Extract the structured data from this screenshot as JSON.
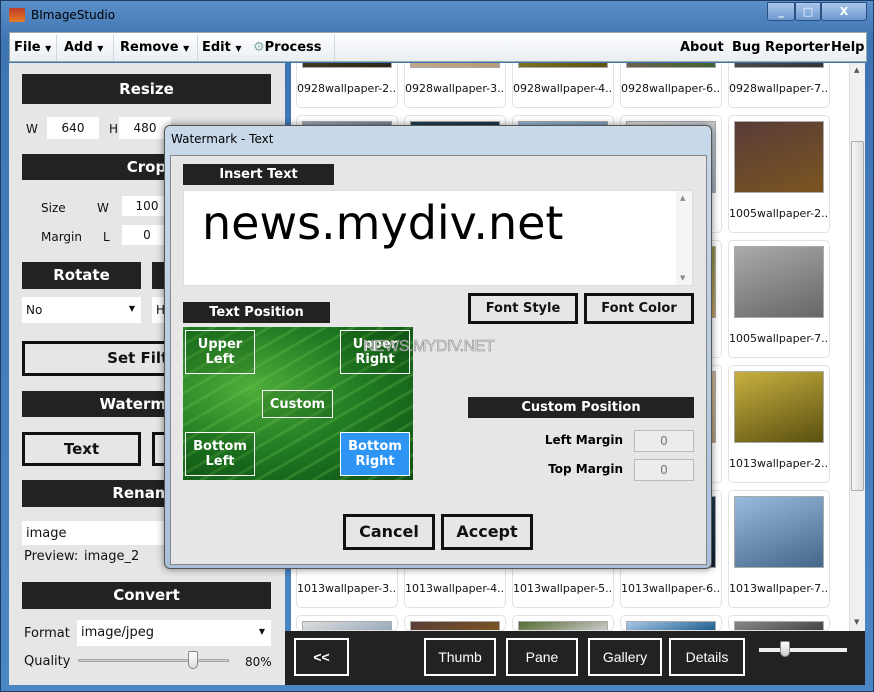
{
  "window": {
    "title": "BImageStudio",
    "minimize": "_",
    "maximize": "□",
    "close": "X"
  },
  "menubar": {
    "left": [
      {
        "label": "File"
      },
      {
        "label": "Add"
      },
      {
        "label": "Remove"
      },
      {
        "label": "Edit"
      },
      {
        "label": "Process"
      }
    ],
    "right": [
      {
        "label": "About"
      },
      {
        "label": "Bug Reporter"
      },
      {
        "label": "Help"
      }
    ]
  },
  "left_panel": {
    "resize": {
      "header": "Resize",
      "w_label": "W",
      "w_value": "640",
      "h_label": "H",
      "h_value": "480"
    },
    "crop": {
      "header": "Crop",
      "size_label": "Size",
      "w_label": "W",
      "w_value": "100",
      "margin_label": "Margin",
      "l_label": "L",
      "l_value": "0"
    },
    "rotate": {
      "header": "Rotate",
      "value": "No",
      "second_value": "H"
    },
    "set_filter": "Set Filter",
    "watermark": {
      "header": "Watermark",
      "text_button": "Text"
    },
    "rename": {
      "header": "Rename",
      "value": "image",
      "preview_label": "Preview:",
      "preview_value": "image_2"
    },
    "convert": {
      "header": "Convert",
      "format_label": "Format",
      "format_value": "image/jpeg",
      "quality_label": "Quality",
      "quality_value": "80%",
      "quality_level": 0.8
    }
  },
  "gallery": {
    "rows": [
      [
        "0928wallpaper-2...",
        "0928wallpaper-3...",
        "0928wallpaper-4...",
        "0928wallpaper-6...",
        "0928wallpaper-7..."
      ],
      [
        "",
        "",
        "",
        "",
        "1005wallpaper-2..."
      ],
      [
        "",
        "",
        "",
        "",
        "1005wallpaper-7..."
      ],
      [
        "",
        "",
        "",
        "",
        "1013wallpaper-2..."
      ],
      [
        "1013wallpaper-3...",
        "1013wallpaper-4...",
        "1013wallpaper-5...",
        "1013wallpaper-6...",
        "1013wallpaper-7..."
      ],
      [
        "",
        "",
        "",
        "",
        ""
      ]
    ]
  },
  "bottom_bar": {
    "collapse": "<<",
    "views": [
      {
        "label": "Thumb"
      },
      {
        "label": "Pane"
      },
      {
        "label": "Gallery"
      },
      {
        "label": "Details"
      }
    ],
    "zoom_level": 0.25
  },
  "dialog": {
    "title": "Watermark - Text",
    "insert_text_header": "Insert Text",
    "text_value": "news.mydiv.net",
    "text_position_header": "Text Position",
    "positions": {
      "upper_left": "Upper Left",
      "upper_right": "Upper Right",
      "custom": "Custom",
      "bottom_left": "Bottom Left",
      "bottom_right": "Bottom Right"
    },
    "selected_position": "Bottom Right",
    "selected_color": "#2f95f5",
    "font_style": "Font Style",
    "font_color": "Font Color",
    "preview_watermark": "NEWS.MYDIV.NET",
    "custom_position_header": "Custom Position",
    "left_margin_label": "Left Margin",
    "left_margin_value": "0",
    "top_margin_label": "Top Margin",
    "top_margin_value": "0",
    "cancel": "Cancel",
    "accept": "Accept"
  }
}
